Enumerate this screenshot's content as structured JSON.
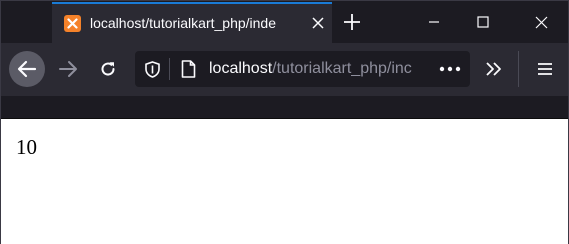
{
  "tab": {
    "title": "localhost/tutorialkart_php/inde",
    "favicon": "xampp-icon"
  },
  "urlbar": {
    "host": "localhost",
    "path": "/tutorialkart_php/inc"
  },
  "page": {
    "output": "10"
  },
  "colors": {
    "accent": "#1a7bd6",
    "toolbar": "#2b2a33",
    "tabstrip": "#1c1b22",
    "favicon": "#f5822a"
  }
}
